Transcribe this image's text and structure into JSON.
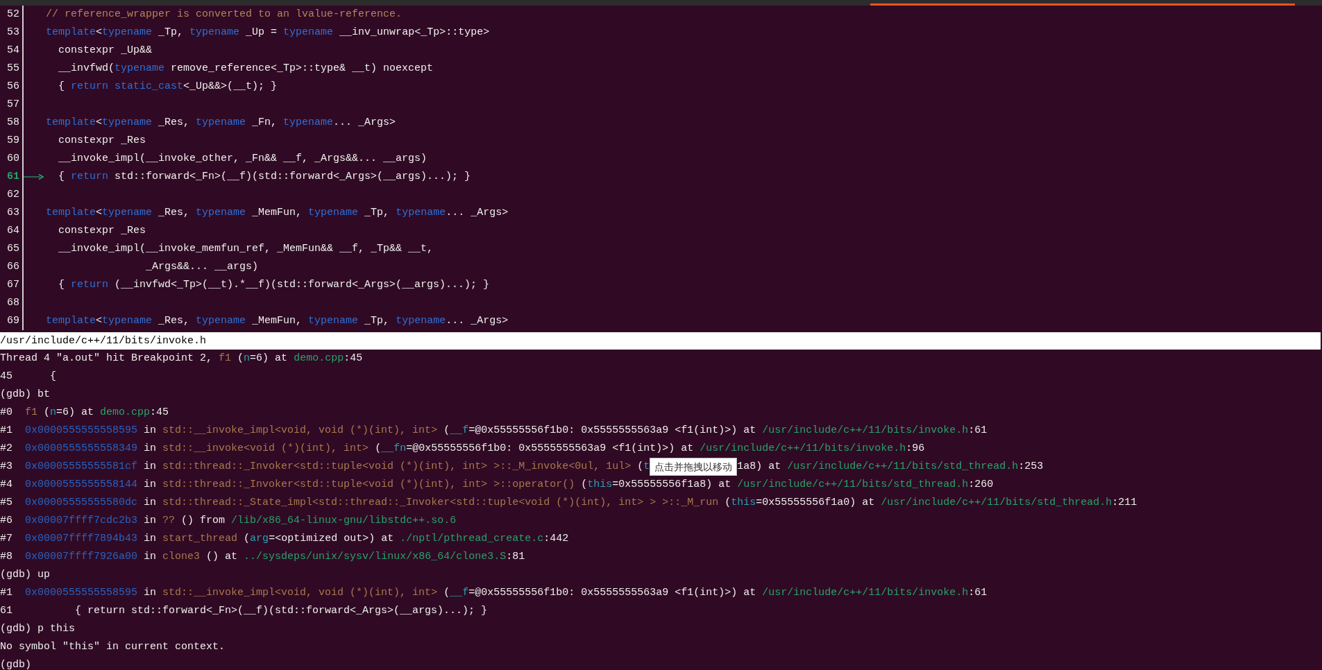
{
  "source": {
    "lines": [
      {
        "number": "52",
        "current": false,
        "segments": [
          {
            "kind": "comment",
            "text": "// reference_wrapper is converted to an lvalue-reference."
          }
        ]
      },
      {
        "number": "53",
        "current": false,
        "segments": [
          {
            "kind": "keyword",
            "text": "template"
          },
          {
            "kind": "plain",
            "text": "<"
          },
          {
            "kind": "keyword",
            "text": "typename"
          },
          {
            "kind": "plain",
            "text": " _Tp, "
          },
          {
            "kind": "keyword",
            "text": "typename"
          },
          {
            "kind": "plain",
            "text": " _Up = "
          },
          {
            "kind": "keyword",
            "text": "typename"
          },
          {
            "kind": "plain",
            "text": " __inv_unwrap<_Tp>::type>"
          }
        ]
      },
      {
        "number": "54",
        "current": false,
        "segments": [
          {
            "kind": "plain",
            "text": "  constexpr _Up&&"
          }
        ]
      },
      {
        "number": "55",
        "current": false,
        "segments": [
          {
            "kind": "plain",
            "text": "  __invfwd("
          },
          {
            "kind": "keyword",
            "text": "typename"
          },
          {
            "kind": "plain",
            "text": " remove_reference<_Tp>::type& __t) noexcept"
          }
        ]
      },
      {
        "number": "56",
        "current": false,
        "segments": [
          {
            "kind": "plain",
            "text": "  { "
          },
          {
            "kind": "keyword",
            "text": "return static_cast"
          },
          {
            "kind": "plain",
            "text": "<_Up&&>(__t); }"
          }
        ]
      },
      {
        "number": "57",
        "current": false
      },
      {
        "number": "58",
        "current": false,
        "segments": [
          {
            "kind": "keyword",
            "text": "template"
          },
          {
            "kind": "plain",
            "text": "<"
          },
          {
            "kind": "keyword",
            "text": "typename"
          },
          {
            "kind": "plain",
            "text": " _Res, "
          },
          {
            "kind": "keyword",
            "text": "typename"
          },
          {
            "kind": "plain",
            "text": " _Fn, "
          },
          {
            "kind": "keyword",
            "text": "typename"
          },
          {
            "kind": "plain",
            "text": "... _Args>"
          }
        ]
      },
      {
        "number": "59",
        "current": false,
        "segments": [
          {
            "kind": "plain",
            "text": "  constexpr _Res"
          }
        ]
      },
      {
        "number": "60",
        "current": false,
        "segments": [
          {
            "kind": "plain",
            "text": "  __invoke_impl(__invoke_other, _Fn&& __f, _Args&&... __args)"
          }
        ]
      },
      {
        "number": "61",
        "current": true,
        "segments": [
          {
            "kind": "plain",
            "text": "  { "
          },
          {
            "kind": "keyword",
            "text": "return"
          },
          {
            "kind": "plain",
            "text": " std::forward<_Fn>(__f)(std::forward<_Args>(__args)...); }"
          }
        ]
      },
      {
        "number": "62",
        "current": false
      },
      {
        "number": "63",
        "current": false,
        "segments": [
          {
            "kind": "keyword",
            "text": "template"
          },
          {
            "kind": "plain",
            "text": "<"
          },
          {
            "kind": "keyword",
            "text": "typename"
          },
          {
            "kind": "plain",
            "text": " _Res, "
          },
          {
            "kind": "keyword",
            "text": "typename"
          },
          {
            "kind": "plain",
            "text": " _MemFun, "
          },
          {
            "kind": "keyword",
            "text": "typename"
          },
          {
            "kind": "plain",
            "text": " _Tp, "
          },
          {
            "kind": "keyword",
            "text": "typename"
          },
          {
            "kind": "plain",
            "text": "... _Args>"
          }
        ]
      },
      {
        "number": "64",
        "current": false,
        "segments": [
          {
            "kind": "plain",
            "text": "  constexpr _Res"
          }
        ]
      },
      {
        "number": "65",
        "current": false,
        "segments": [
          {
            "kind": "plain",
            "text": "  __invoke_impl(__invoke_memfun_ref, _MemFun&& __f, _Tp&& __t,"
          }
        ]
      },
      {
        "number": "66",
        "current": false,
        "segments": [
          {
            "kind": "plain",
            "text": "                _Args&&... __args)"
          }
        ]
      },
      {
        "number": "67",
        "current": false,
        "segments": [
          {
            "kind": "plain",
            "text": "  { "
          },
          {
            "kind": "keyword",
            "text": "return"
          },
          {
            "kind": "plain",
            "text": " (__invfwd<_Tp>(__t).*__f)(std::forward<_Args>(__args)...); }"
          }
        ]
      },
      {
        "number": "68",
        "current": false
      },
      {
        "number": "69",
        "current": false,
        "segments": [
          {
            "kind": "keyword",
            "text": "template"
          },
          {
            "kind": "plain",
            "text": "<"
          },
          {
            "kind": "keyword",
            "text": "typename"
          },
          {
            "kind": "plain",
            "text": " _Res, "
          },
          {
            "kind": "keyword",
            "text": "typename"
          },
          {
            "kind": "plain",
            "text": " _MemFun, "
          },
          {
            "kind": "keyword",
            "text": "typename"
          },
          {
            "kind": "plain",
            "text": " _Tp, "
          },
          {
            "kind": "keyword",
            "text": "typename"
          },
          {
            "kind": "plain",
            "text": "... _Args>"
          }
        ]
      }
    ]
  },
  "status_bar": {
    "file": "/usr/include/c++/11/bits/invoke.h"
  },
  "console": {
    "lines": [
      {
        "segments": [
          {
            "kind": "plain",
            "text": "Thread 4 \"a.out\" hit Breakpoint 2, "
          },
          {
            "kind": "function",
            "text": "f1"
          },
          {
            "kind": "plain",
            "text": " ("
          },
          {
            "kind": "argument",
            "text": "n"
          },
          {
            "kind": "plain",
            "text": "=6) at "
          },
          {
            "kind": "path",
            "text": "demo.cpp"
          },
          {
            "kind": "plain",
            "text": ":45"
          }
        ]
      },
      {
        "segments": [
          {
            "kind": "plain",
            "text": "45      {"
          }
        ]
      },
      {
        "segments": [
          {
            "kind": "plain",
            "text": "(gdb) bt"
          }
        ]
      },
      {
        "segments": [
          {
            "kind": "plain",
            "text": "#0  "
          },
          {
            "kind": "function",
            "text": "f1"
          },
          {
            "kind": "plain",
            "text": " ("
          },
          {
            "kind": "argument",
            "text": "n"
          },
          {
            "kind": "plain",
            "text": "=6) at "
          },
          {
            "kind": "path",
            "text": "demo.cpp"
          },
          {
            "kind": "plain",
            "text": ":45"
          }
        ]
      },
      {
        "segments": [
          {
            "kind": "plain",
            "text": "#1  "
          },
          {
            "kind": "address",
            "text": "0x0000555555558595"
          },
          {
            "kind": "plain",
            "text": " in "
          },
          {
            "kind": "function",
            "text": "std::__invoke_impl<void, void (*)(int), int>"
          },
          {
            "kind": "plain",
            "text": " ("
          },
          {
            "kind": "argument",
            "text": "__f"
          },
          {
            "kind": "plain",
            "text": "=@0x55555556f1b0: 0x5555555563a9 <f1(int)>) at "
          },
          {
            "kind": "path",
            "text": "/usr/include/c++/11/bits/invoke.h"
          },
          {
            "kind": "plain",
            "text": ":61"
          }
        ]
      },
      {
        "segments": [
          {
            "kind": "plain",
            "text": "#2  "
          },
          {
            "kind": "address",
            "text": "0x0000555555558349"
          },
          {
            "kind": "plain",
            "text": " in "
          },
          {
            "kind": "function",
            "text": "std::__invoke<void (*)(int), int>"
          },
          {
            "kind": "plain",
            "text": " ("
          },
          {
            "kind": "argument",
            "text": "__fn"
          },
          {
            "kind": "plain",
            "text": "=@0x55555556f1b0: 0x5555555563a9 <f1(int)>) at "
          },
          {
            "kind": "path",
            "text": "/usr/include/c++/11/bits/invoke.h"
          },
          {
            "kind": "plain",
            "text": ":96"
          }
        ]
      },
      {
        "segments": [
          {
            "kind": "plain",
            "text": "#3  "
          },
          {
            "kind": "address",
            "text": "0x00005555555581cf"
          },
          {
            "kind": "plain",
            "text": " in "
          },
          {
            "kind": "function",
            "text": "std::thread::_Invoker<std::tuple<void (*)(int), int> >::_M_invoke<0ul, 1ul>"
          },
          {
            "kind": "plain",
            "text": " ("
          },
          {
            "kind": "argument",
            "text": "t"
          }
        ],
        "tooltip": {
          "text": "点击并拖拽以移动"
        },
        "segments_after": [
          {
            "kind": "plain",
            "text": "1a8) at "
          },
          {
            "kind": "path",
            "text": "/usr/include/c++/11/bits/std_thread.h"
          },
          {
            "kind": "plain",
            "text": ":253"
          }
        ]
      },
      {
        "segments": [
          {
            "kind": "plain",
            "text": "#4  "
          },
          {
            "kind": "address",
            "text": "0x0000555555558144"
          },
          {
            "kind": "plain",
            "text": " in "
          },
          {
            "kind": "function",
            "text": "std::thread::_Invoker<std::tuple<void (*)(int), int> >::operator()"
          },
          {
            "kind": "plain",
            "text": " ("
          },
          {
            "kind": "argument",
            "text": "this"
          },
          {
            "kind": "plain",
            "text": "=0x55555556f1a8) at "
          },
          {
            "kind": "path",
            "text": "/usr/include/c++/11/bits/std_thread.h"
          },
          {
            "kind": "plain",
            "text": ":260"
          }
        ]
      },
      {
        "segments": [
          {
            "kind": "plain",
            "text": "#5  "
          },
          {
            "kind": "address",
            "text": "0x00005555555580dc"
          },
          {
            "kind": "plain",
            "text": " in "
          },
          {
            "kind": "function",
            "text": "std::thread::_State_impl<std::thread::_Invoker<std::tuple<void (*)(int), int> > >::_M_run"
          },
          {
            "kind": "plain",
            "text": " ("
          },
          {
            "kind": "argument",
            "text": "this"
          },
          {
            "kind": "plain",
            "text": "=0x55555556f1a0) at "
          },
          {
            "kind": "path",
            "text": "/usr/include/c++/11/bits/std_thread.h"
          },
          {
            "kind": "plain",
            "text": ":211"
          }
        ]
      },
      {
        "segments": [
          {
            "kind": "plain",
            "text": "#6  "
          },
          {
            "kind": "address",
            "text": "0x00007ffff7cdc2b3"
          },
          {
            "kind": "plain",
            "text": " in "
          },
          {
            "kind": "function",
            "text": "??"
          },
          {
            "kind": "plain",
            "text": " () from "
          },
          {
            "kind": "path",
            "text": "/lib/x86_64-linux-gnu/libstdc++.so.6"
          }
        ]
      },
      {
        "segments": [
          {
            "kind": "plain",
            "text": "#7  "
          },
          {
            "kind": "address",
            "text": "0x00007ffff7894b43"
          },
          {
            "kind": "plain",
            "text": " in "
          },
          {
            "kind": "function",
            "text": "start_thread"
          },
          {
            "kind": "plain",
            "text": " ("
          },
          {
            "kind": "argument",
            "text": "arg"
          },
          {
            "kind": "plain",
            "text": "=<optimized out>) at "
          },
          {
            "kind": "path",
            "text": "./nptl/pthread_create.c"
          },
          {
            "kind": "plain",
            "text": ":442"
          }
        ]
      },
      {
        "segments": [
          {
            "kind": "plain",
            "text": "#8  "
          },
          {
            "kind": "address",
            "text": "0x00007ffff7926a00"
          },
          {
            "kind": "plain",
            "text": " in "
          },
          {
            "kind": "function",
            "text": "clone3"
          },
          {
            "kind": "plain",
            "text": " () at "
          },
          {
            "kind": "path",
            "text": "../sysdeps/unix/sysv/linux/x86_64/clone3.S"
          },
          {
            "kind": "plain",
            "text": ":81"
          }
        ]
      },
      {
        "segments": [
          {
            "kind": "plain",
            "text": "(gdb) up"
          }
        ]
      },
      {
        "segments": [
          {
            "kind": "plain",
            "text": "#1  "
          },
          {
            "kind": "address",
            "text": "0x0000555555558595"
          },
          {
            "kind": "plain",
            "text": " in "
          },
          {
            "kind": "function",
            "text": "std::__invoke_impl<void, void (*)(int), int>"
          },
          {
            "kind": "plain",
            "text": " ("
          },
          {
            "kind": "argument",
            "text": "__f"
          },
          {
            "kind": "plain",
            "text": "=@0x55555556f1b0: 0x5555555563a9 <f1(int)>) at "
          },
          {
            "kind": "path",
            "text": "/usr/include/c++/11/bits/invoke.h"
          },
          {
            "kind": "plain",
            "text": ":61"
          }
        ]
      },
      {
        "segments": [
          {
            "kind": "plain",
            "text": "61          { return std::forward<_Fn>(__f)(std::forward<_Args>(__args)...); }"
          }
        ]
      },
      {
        "segments": [
          {
            "kind": "plain",
            "text": "(gdb) p this"
          }
        ]
      },
      {
        "segments": [
          {
            "kind": "plain",
            "text": "No symbol \"this\" in current context."
          }
        ]
      },
      {
        "segments": [
          {
            "kind": "plain",
            "text": "(gdb)"
          }
        ]
      }
    ]
  }
}
